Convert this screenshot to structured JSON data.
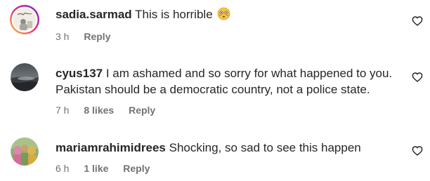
{
  "comments": [
    {
      "username": "sadia.sarmad",
      "text": "This is horrible",
      "emoji_icon": "flushed-face-icon",
      "time": "3 h",
      "likes": "",
      "reply_label": "Reply"
    },
    {
      "username": "cyus137",
      "text": "I am ashamed and so sorry for what happened to you. Pakistan should be a democratic country, not a police state.",
      "time": "7 h",
      "likes": "8 likes",
      "reply_label": "Reply"
    },
    {
      "username": "mariamrahimidrees",
      "text": "Shocking, so sad to see this happen",
      "time": "6 h",
      "likes": "1 like",
      "reply_label": "Reply"
    }
  ],
  "colors": {
    "text": "#262626",
    "secondary": "#737373",
    "story_ring_start": "#f9ce34",
    "story_ring_end": "#ee2a7b"
  }
}
